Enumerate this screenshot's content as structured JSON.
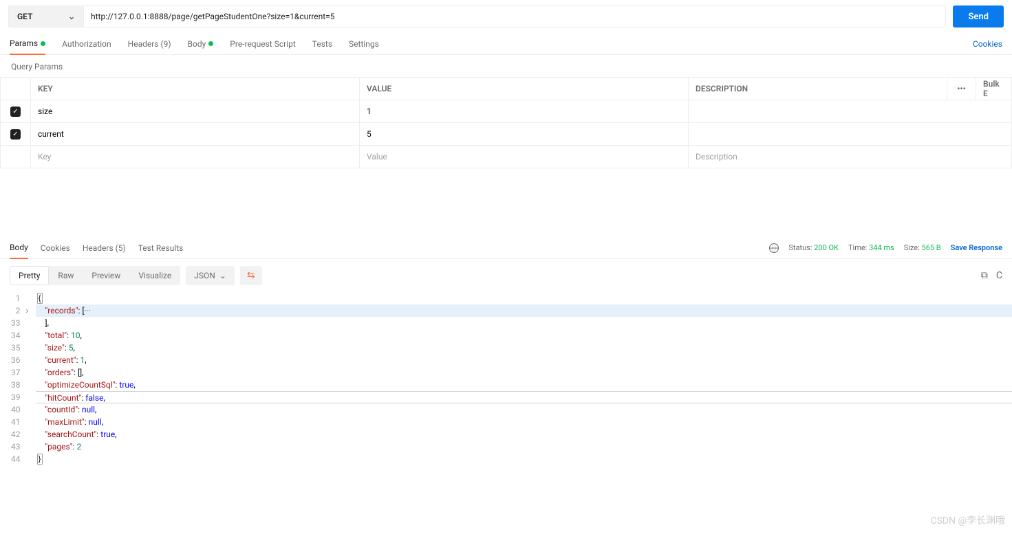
{
  "request": {
    "method": "GET",
    "url": "http://127.0.0.1:8888/page/getPageStudentOne?size=1&current=5",
    "send_label": "Send"
  },
  "req_tabs": {
    "params": "Params",
    "authorization": "Authorization",
    "headers": "Headers (9)",
    "body": "Body",
    "prerequest": "Pre-request Script",
    "tests": "Tests",
    "settings": "Settings",
    "cookies": "Cookies"
  },
  "params_section": {
    "title": "Query Params",
    "headers": {
      "key": "KEY",
      "value": "VALUE",
      "description": "DESCRIPTION",
      "bulk": "Bulk E"
    },
    "placeholders": {
      "key": "Key",
      "value": "Value",
      "description": "Description"
    },
    "rows": [
      {
        "checked": true,
        "key": "size",
        "value": "1",
        "description": ""
      },
      {
        "checked": true,
        "key": "current",
        "value": "5",
        "description": ""
      }
    ]
  },
  "resp_tabs": {
    "body": "Body",
    "cookies": "Cookies",
    "headers": "Headers (5)",
    "test_results": "Test Results"
  },
  "resp_meta": {
    "status_label": "Status:",
    "status_value": "200 OK",
    "time_label": "Time:",
    "time_value": "344 ms",
    "size_label": "Size:",
    "size_value": "565 B",
    "save": "Save Response"
  },
  "view_modes": {
    "pretty": "Pretty",
    "raw": "Raw",
    "preview": "Preview",
    "visualize": "Visualize",
    "format": "JSON"
  },
  "json_body": {
    "line_numbers": [
      "1",
      "2",
      "33",
      "34",
      "35",
      "36",
      "37",
      "38",
      "39",
      "40",
      "41",
      "42",
      "43",
      "44"
    ],
    "records_key": "\"records\"",
    "total_key": "\"total\"",
    "total_val": "10",
    "size_key": "\"size\"",
    "size_val": "5",
    "current_key": "\"current\"",
    "current_val": "1",
    "orders_key": "\"orders\"",
    "optimize_key": "\"optimizeCountSql\"",
    "optimize_val": "true",
    "hit_key": "\"hitCount\"",
    "hit_val": "false",
    "countid_key": "\"countId\"",
    "countid_val": "null",
    "maxlimit_key": "\"maxLimit\"",
    "maxlimit_val": "null",
    "search_key": "\"searchCount\"",
    "search_val": "true",
    "pages_key": "\"pages\"",
    "pages_val": "2"
  },
  "watermark": "CSDN @李长渊哦"
}
